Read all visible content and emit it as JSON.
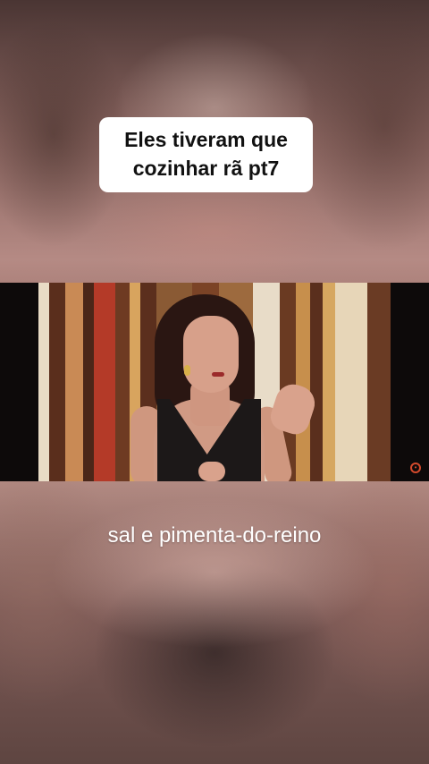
{
  "caption": {
    "lines": [
      "Eles tiveram que",
      "cozinhar rã pt7"
    ]
  },
  "video": {
    "subtitle": "sal e pimenta-do-reino",
    "watermark_icon": "channel-logo-icon",
    "colors": {
      "studio_wood": "#7a4a30",
      "dress": "#1c1818",
      "watermark": "#d24a2c"
    }
  }
}
